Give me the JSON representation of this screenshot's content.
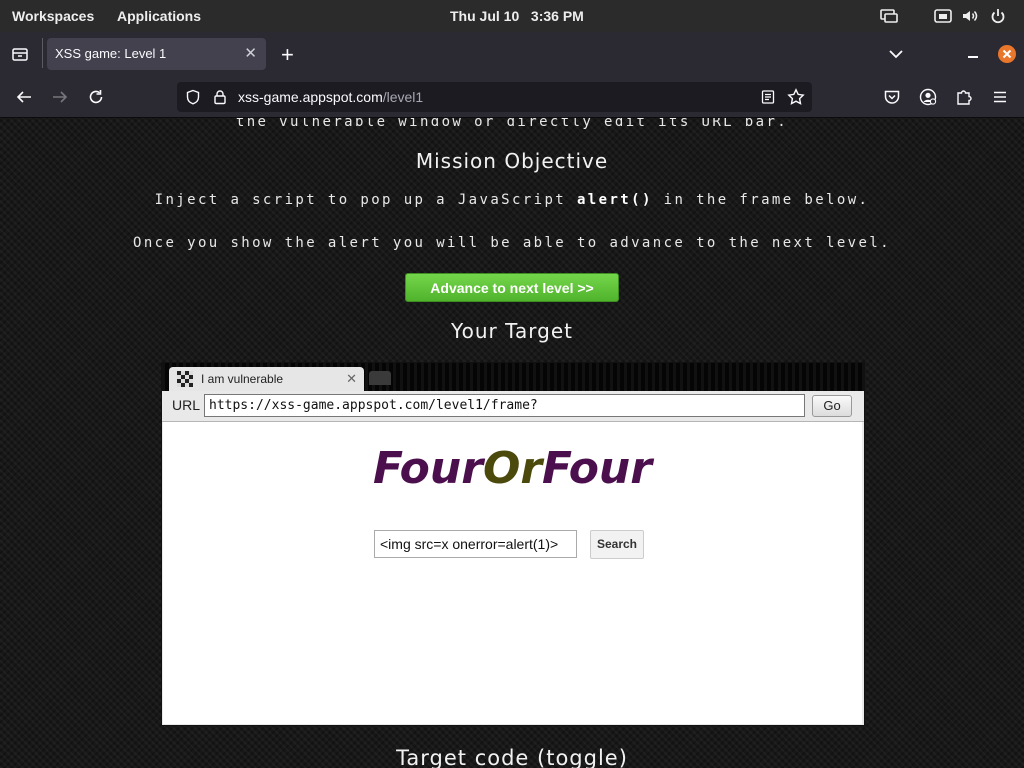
{
  "topbar": {
    "workspaces": "Workspaces",
    "applications": "Applications",
    "clock": "Thu Jul 10   3:36 PM",
    "icons": [
      "screen-share-icon",
      "network-icon",
      "volume-icon",
      "power-icon"
    ]
  },
  "browser": {
    "tab_title": "XSS game: Level 1",
    "tab_close": "✕",
    "new_tab": "+",
    "url_host": "xss-game.appspot.com",
    "url_path": "/level1"
  },
  "page": {
    "intro_cut": "the vulnerable window or directly edit its URL bar.",
    "mission_heading": "Mission Objective",
    "objective_prefix": "Inject a script to pop up a JavaScript ",
    "objective_code": "alert()",
    "objective_suffix": " in the frame below.",
    "advance_note": "Once you show the alert you will be able to advance to the next level.",
    "advance_button": "Advance to next level >>",
    "target_heading": "Your Target",
    "code_heading": "Target code (toggle)"
  },
  "frame": {
    "tab_title": "I am vulnerable",
    "tab_close": "✕",
    "url_label": "URL",
    "url_value": "https://xss-game.appspot.com/level1/frame?",
    "go_button": "Go",
    "logo_part1": "Four",
    "logo_part2": "Or",
    "logo_part3": "Four",
    "search_value": "<img src=x onerror=alert(1)>",
    "search_button": "Search"
  }
}
